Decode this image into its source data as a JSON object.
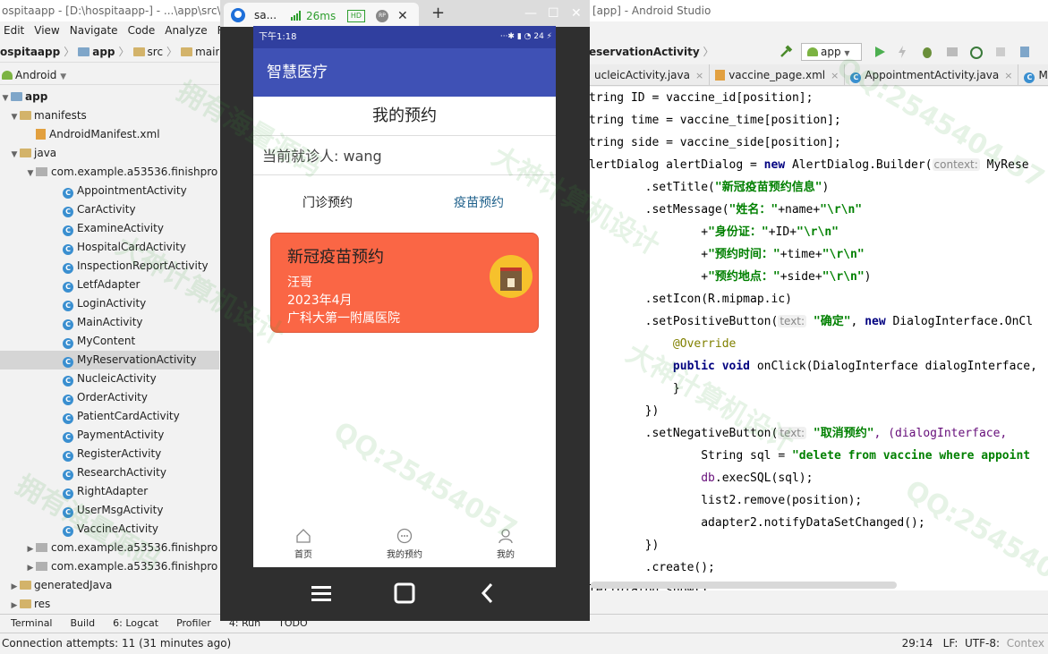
{
  "ide": {
    "title_left": "ospitaapp - [D:\\hospitaapp-] - ...\\app\\src\\m",
    "title_right": "[app] - Android Studio",
    "menu": [
      "Edit",
      "View",
      "Navigate",
      "Code",
      "Analyze",
      "R"
    ],
    "crumbs": [
      "ospitaapp",
      "app",
      "src",
      "main"
    ],
    "editor_crumb": "eservationActivity",
    "run_config": "app",
    "project_view": "Android",
    "tree": {
      "app": "app",
      "manifests": "manifests",
      "manifest_file": "AndroidManifest.xml",
      "java": "java",
      "package_main": "com.example.a53536.finishpro",
      "classes": [
        "AppointmentActivity",
        "CarActivity",
        "ExamineActivity",
        "HospitalCardActivity",
        "InspectionReportActivity",
        "LetfAdapter",
        "LoginActivity",
        "MainActivity",
        "MyContent",
        "MyReservationActivity",
        "NucleicActivity",
        "OrderActivity",
        "PatientCardActivity",
        "PaymentActivity",
        "RegisterActivity",
        "ResearchActivity",
        "RightAdapter",
        "UserMsgActivity",
        "VaccineActivity"
      ],
      "selected": "MyReservationActivity",
      "package_2": "com.example.a53536.finishpro",
      "package_3": "com.example.a53536.finishpro",
      "generated": "generatedJava",
      "res": "res"
    },
    "tabs": [
      "ucleicActivity.java",
      "vaccine_page.xml",
      "AppointmentActivity.java",
      "MyRe"
    ],
    "code": {
      "l1": "tring ID = vaccine_id[position];",
      "l2": "tring time = vaccine_time[position];",
      "l3": "tring side = vaccine_side[position];",
      "l4a": "lertDialog alertDialog = ",
      "l4b": "new",
      "l4c": " AlertDialog.Builder(",
      "l4hint": "context:",
      "l4d": " MyRese",
      "l5a": "        .setTitle(",
      "l5b": "\"新冠疫苗预约信息\"",
      "l5c": ")",
      "l6a": "        .setMessage(",
      "l6b": "\"姓名：\"",
      "l6c": "+name+",
      "l6d": "\"\\r\\n\"",
      "l7a": "                +",
      "l7b": "\"身份证：\"",
      "l7c": "+ID+",
      "l7d": "\"\\r\\n\"",
      "l8b": "\"预约时间：\"",
      "l8c": "+time+",
      "l9b": "\"预约地点：\"",
      "l9c": "+side+",
      "l9e": ")",
      "l10": "        .setIcon(R.mipmap.ic)",
      "l11a": "        .setPositiveButton(",
      "l11hint": "text:",
      "l11b": " \"确定\"",
      "l11c": ", ",
      "l11d": "new",
      "l11e": " DialogInterface.OnCl",
      "l12": "            @Override",
      "l13a": "            public void",
      "l13b": " onClick(DialogInterface dialogInterface,",
      "l14": "            }",
      "l15": "        })",
      "l16a": "        .setNegativeButton(",
      "l16hint": "text:",
      "l16b": " \"取消预约\"",
      "l16c": ", (dialogInterface,",
      "l17a": "                String sql = ",
      "l17b": "\"delete from vaccine where appoint",
      "l18a": "                ",
      "l18b": "db",
      "l18c": ".execSQL(sql);",
      "l19": "                list2.remove(position);",
      "l20": "                adapter2.notifyDataSetChanged();",
      "l21": "        })",
      "l22": "        .create();",
      "l23": "lertDialog.show();"
    },
    "toolwindows": [
      "Terminal",
      "Build",
      "6: Logcat",
      "Profiler",
      "4: Run",
      "TODO"
    ],
    "status_left": "Connection attempts: 11 (31 minutes ago)",
    "status_pos": "29:14",
    "status_lf": "LF:",
    "status_enc": "UTF-8:",
    "status_ctx": "Contex"
  },
  "emulator": {
    "tab_name": "sa...",
    "latency": "26ms",
    "hd": "HD",
    "rp": "RP",
    "phone": {
      "time": "下午1:18",
      "status_icons": "···✱ ▮ ◔ 24 ⚡",
      "app_title": "智慧医疗",
      "page_title": "我的预约",
      "patient_label": "当前就诊人: wang",
      "tabs": [
        "门诊预约",
        "疫苗预约"
      ],
      "card": {
        "title": "新冠疫苗预约",
        "name": "汪哥",
        "date": "2023年4月",
        "place": "广科大第一附属医院"
      },
      "nav": [
        "首页",
        "我的预约",
        "我的"
      ]
    }
  },
  "watermarks": [
    "拥有海量源码",
    "大神计算机设计",
    "QQ:2545404 57",
    "QQ:25454057",
    "大神计算机设计",
    "拥有海量源码",
    "QQ:2545404",
    "大神计算机设计"
  ]
}
